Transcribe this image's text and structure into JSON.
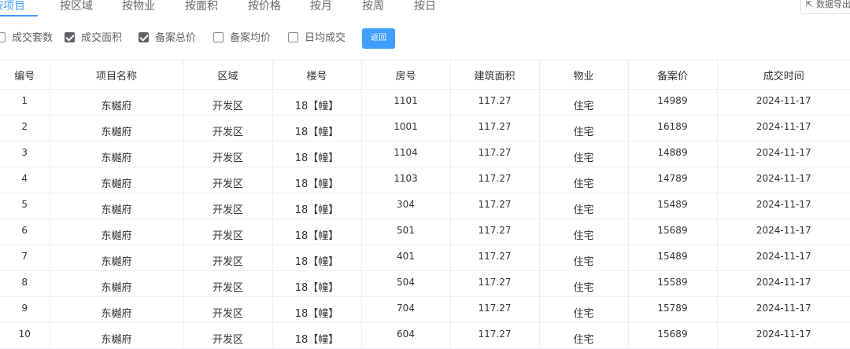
{
  "tabs": [
    "按项目",
    "按区域",
    "按物业",
    "按面积",
    "按价格",
    "按月",
    "按周",
    "按日"
  ],
  "active_tab": 0,
  "export_label": "数据导出",
  "filters": [
    {
      "label": "成交套数",
      "checked": false
    },
    {
      "label": "成交面积",
      "checked": true
    },
    {
      "label": "备案总价",
      "checked": true
    },
    {
      "label": "备案均价",
      "checked": false
    },
    {
      "label": "日均成交",
      "checked": false
    }
  ],
  "back_label": "返回",
  "table": {
    "headers": [
      "编号",
      "项目名称",
      "区域",
      "楼号",
      "房号",
      "建筑面积",
      "物业",
      "备案价",
      "成交时间"
    ],
    "rows": [
      [
        "1",
        "东樾府",
        "开发区",
        "18【幢】",
        "1101",
        "117.27",
        "住宅",
        "14989",
        "2024-11-17"
      ],
      [
        "2",
        "东樾府",
        "开发区",
        "18【幢】",
        "1001",
        "117.27",
        "住宅",
        "16189",
        "2024-11-17"
      ],
      [
        "3",
        "东樾府",
        "开发区",
        "18【幢】",
        "1104",
        "117.27",
        "住宅",
        "14889",
        "2024-11-17"
      ],
      [
        "4",
        "东樾府",
        "开发区",
        "18【幢】",
        "1103",
        "117.27",
        "住宅",
        "14789",
        "2024-11-17"
      ],
      [
        "5",
        "东樾府",
        "开发区",
        "18【幢】",
        "304",
        "117.27",
        "住宅",
        "15489",
        "2024-11-17"
      ],
      [
        "6",
        "东樾府",
        "开发区",
        "18【幢】",
        "501",
        "117.27",
        "住宅",
        "15689",
        "2024-11-17"
      ],
      [
        "7",
        "东樾府",
        "开发区",
        "18【幢】",
        "401",
        "117.27",
        "住宅",
        "15489",
        "2024-11-17"
      ],
      [
        "8",
        "东樾府",
        "开发区",
        "18【幢】",
        "504",
        "117.27",
        "住宅",
        "15589",
        "2024-11-17"
      ],
      [
        "9",
        "东樾府",
        "开发区",
        "18【幢】",
        "704",
        "117.27",
        "住宅",
        "15789",
        "2024-11-17"
      ],
      [
        "10",
        "东樾府",
        "开发区",
        "18【幢】",
        "604",
        "117.27",
        "住宅",
        "15689",
        "2024-11-17"
      ]
    ]
  },
  "colors": {
    "accent": "#409EFF",
    "border": "#ebeef5",
    "text": "#333333"
  }
}
